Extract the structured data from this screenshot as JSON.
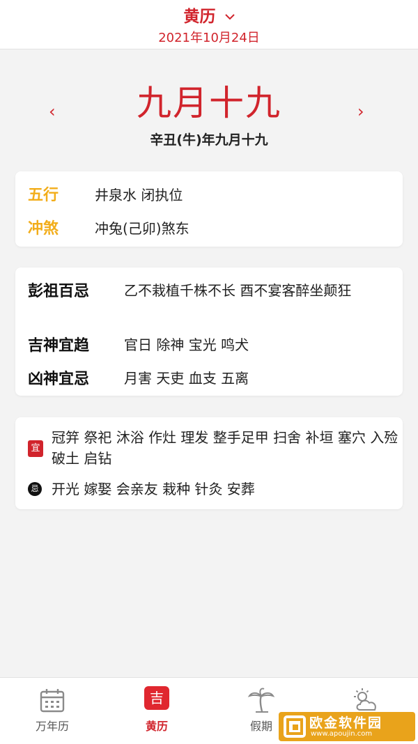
{
  "header": {
    "title": "黄历",
    "date": "2021年10月24日"
  },
  "lunar": {
    "prev_arrow": "‹",
    "next_arrow": "›",
    "day_big": "九月十九",
    "day_full": "辛丑(牛)年九月十九"
  },
  "card1": {
    "rows": [
      {
        "label": "五行",
        "value": "井泉水 闭执位"
      },
      {
        "label": "冲煞",
        "value": "冲兔(己卯)煞东"
      }
    ]
  },
  "card2": {
    "rows": [
      {
        "label": "彭祖百忌",
        "value": "乙不栽植千株不长 酉不宴客醉坐颠狂"
      },
      {
        "label": "吉神宜趋",
        "value": "官日 除神 宝光 鸣犬"
      },
      {
        "label": "凶神宜忌",
        "value": "月害 天吏 血支 五离"
      }
    ]
  },
  "card3": {
    "yi_tag": "宜",
    "yi_items": "冠笄 祭祀 沐浴 作灶 理发 整手足甲 扫舍 补垣 塞穴 入殓 破土 启钻",
    "ji_tag": "忌",
    "ji_items": "开光 嫁娶 会亲友 栽种 针灸 安葬"
  },
  "tabbar": {
    "tabs": [
      {
        "label": "万年历",
        "icon": "calendar-icon"
      },
      {
        "label": "黄历",
        "icon": "ji-badge-icon",
        "badge": "吉"
      },
      {
        "label": "假期",
        "icon": "palm-tree-icon"
      },
      {
        "label": "",
        "icon": "weather-icon"
      }
    ]
  },
  "watermark": {
    "text": "欧金软件园",
    "url": "www.apoujin.com"
  },
  "colors": {
    "accent": "#d1242c",
    "label_gold": "#f2ad1a",
    "background": "#f3f3f3"
  }
}
